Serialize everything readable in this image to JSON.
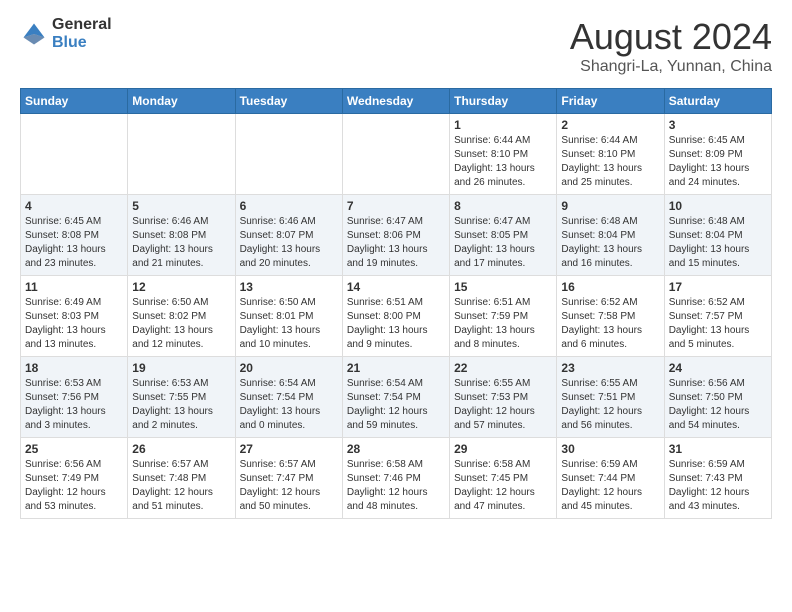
{
  "header": {
    "logo_text_general": "General",
    "logo_text_blue": "Blue",
    "title": "August 2024",
    "subtitle": "Shangri-La, Yunnan, China"
  },
  "calendar": {
    "days_of_week": [
      "Sunday",
      "Monday",
      "Tuesday",
      "Wednesday",
      "Thursday",
      "Friday",
      "Saturday"
    ],
    "weeks": [
      [
        {
          "day": "",
          "info": ""
        },
        {
          "day": "",
          "info": ""
        },
        {
          "day": "",
          "info": ""
        },
        {
          "day": "",
          "info": ""
        },
        {
          "day": "1",
          "info": "Sunrise: 6:44 AM\nSunset: 8:10 PM\nDaylight: 13 hours and 26 minutes."
        },
        {
          "day": "2",
          "info": "Sunrise: 6:44 AM\nSunset: 8:10 PM\nDaylight: 13 hours and 25 minutes."
        },
        {
          "day": "3",
          "info": "Sunrise: 6:45 AM\nSunset: 8:09 PM\nDaylight: 13 hours and 24 minutes."
        }
      ],
      [
        {
          "day": "4",
          "info": "Sunrise: 6:45 AM\nSunset: 8:08 PM\nDaylight: 13 hours and 23 minutes."
        },
        {
          "day": "5",
          "info": "Sunrise: 6:46 AM\nSunset: 8:08 PM\nDaylight: 13 hours and 21 minutes."
        },
        {
          "day": "6",
          "info": "Sunrise: 6:46 AM\nSunset: 8:07 PM\nDaylight: 13 hours and 20 minutes."
        },
        {
          "day": "7",
          "info": "Sunrise: 6:47 AM\nSunset: 8:06 PM\nDaylight: 13 hours and 19 minutes."
        },
        {
          "day": "8",
          "info": "Sunrise: 6:47 AM\nSunset: 8:05 PM\nDaylight: 13 hours and 17 minutes."
        },
        {
          "day": "9",
          "info": "Sunrise: 6:48 AM\nSunset: 8:04 PM\nDaylight: 13 hours and 16 minutes."
        },
        {
          "day": "10",
          "info": "Sunrise: 6:48 AM\nSunset: 8:04 PM\nDaylight: 13 hours and 15 minutes."
        }
      ],
      [
        {
          "day": "11",
          "info": "Sunrise: 6:49 AM\nSunset: 8:03 PM\nDaylight: 13 hours and 13 minutes."
        },
        {
          "day": "12",
          "info": "Sunrise: 6:50 AM\nSunset: 8:02 PM\nDaylight: 13 hours and 12 minutes."
        },
        {
          "day": "13",
          "info": "Sunrise: 6:50 AM\nSunset: 8:01 PM\nDaylight: 13 hours and 10 minutes."
        },
        {
          "day": "14",
          "info": "Sunrise: 6:51 AM\nSunset: 8:00 PM\nDaylight: 13 hours and 9 minutes."
        },
        {
          "day": "15",
          "info": "Sunrise: 6:51 AM\nSunset: 7:59 PM\nDaylight: 13 hours and 8 minutes."
        },
        {
          "day": "16",
          "info": "Sunrise: 6:52 AM\nSunset: 7:58 PM\nDaylight: 13 hours and 6 minutes."
        },
        {
          "day": "17",
          "info": "Sunrise: 6:52 AM\nSunset: 7:57 PM\nDaylight: 13 hours and 5 minutes."
        }
      ],
      [
        {
          "day": "18",
          "info": "Sunrise: 6:53 AM\nSunset: 7:56 PM\nDaylight: 13 hours and 3 minutes."
        },
        {
          "day": "19",
          "info": "Sunrise: 6:53 AM\nSunset: 7:55 PM\nDaylight: 13 hours and 2 minutes."
        },
        {
          "day": "20",
          "info": "Sunrise: 6:54 AM\nSunset: 7:54 PM\nDaylight: 13 hours and 0 minutes."
        },
        {
          "day": "21",
          "info": "Sunrise: 6:54 AM\nSunset: 7:54 PM\nDaylight: 12 hours and 59 minutes."
        },
        {
          "day": "22",
          "info": "Sunrise: 6:55 AM\nSunset: 7:53 PM\nDaylight: 12 hours and 57 minutes."
        },
        {
          "day": "23",
          "info": "Sunrise: 6:55 AM\nSunset: 7:51 PM\nDaylight: 12 hours and 56 minutes."
        },
        {
          "day": "24",
          "info": "Sunrise: 6:56 AM\nSunset: 7:50 PM\nDaylight: 12 hours and 54 minutes."
        }
      ],
      [
        {
          "day": "25",
          "info": "Sunrise: 6:56 AM\nSunset: 7:49 PM\nDaylight: 12 hours and 53 minutes."
        },
        {
          "day": "26",
          "info": "Sunrise: 6:57 AM\nSunset: 7:48 PM\nDaylight: 12 hours and 51 minutes."
        },
        {
          "day": "27",
          "info": "Sunrise: 6:57 AM\nSunset: 7:47 PM\nDaylight: 12 hours and 50 minutes."
        },
        {
          "day": "28",
          "info": "Sunrise: 6:58 AM\nSunset: 7:46 PM\nDaylight: 12 hours and 48 minutes."
        },
        {
          "day": "29",
          "info": "Sunrise: 6:58 AM\nSunset: 7:45 PM\nDaylight: 12 hours and 47 minutes."
        },
        {
          "day": "30",
          "info": "Sunrise: 6:59 AM\nSunset: 7:44 PM\nDaylight: 12 hours and 45 minutes."
        },
        {
          "day": "31",
          "info": "Sunrise: 6:59 AM\nSunset: 7:43 PM\nDaylight: 12 hours and 43 minutes."
        }
      ]
    ]
  }
}
